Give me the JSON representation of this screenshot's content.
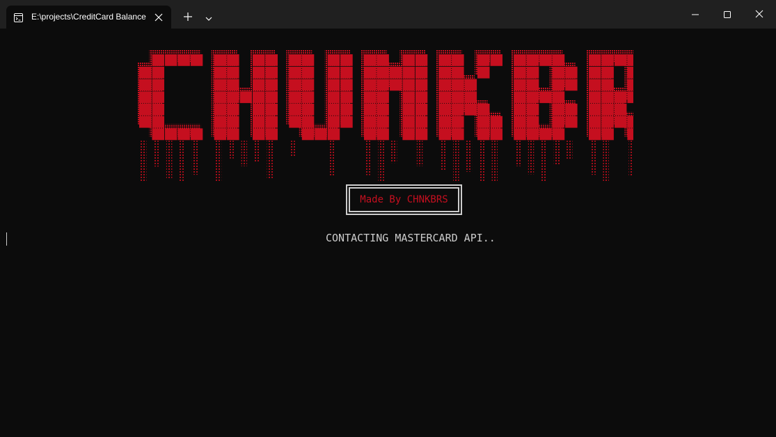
{
  "window": {
    "tab_title": "E:\\projects\\CreditCard Balance Checker",
    "icons": {
      "tab": "terminal-icon",
      "tab_close": "close-icon",
      "new_tab": "plus-icon",
      "dropdown": "chevron-down-icon",
      "minimize": "minimize-icon",
      "maximize": "maximize-icon",
      "close": "close-icon"
    }
  },
  "terminal": {
    "logo_text": "CHUNKBROS",
    "badge_text": "Made By CHNKBRS",
    "status_text": "CONTACTING MASTERCARD API..",
    "colors": {
      "background": "#0c0c0c",
      "logo_red": "#c50f1f",
      "text": "#cccccc"
    }
  }
}
